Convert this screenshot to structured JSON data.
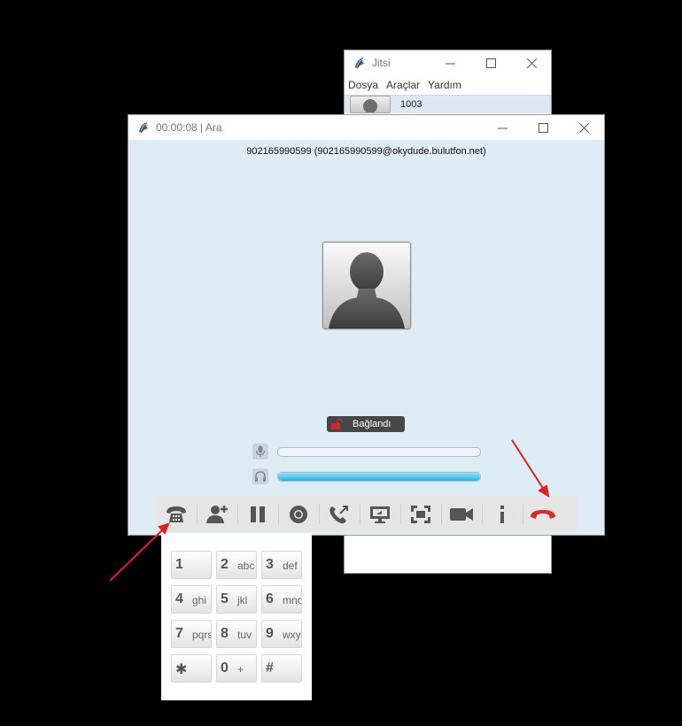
{
  "jitsi_window": {
    "title": "Jitsi",
    "menu": [
      "Dosya",
      "Araçlar",
      "Yardım"
    ],
    "contact_number": "1003"
  },
  "call_window": {
    "title": "00:00:08 | Ara",
    "remote_party": "902165990599 (902165990599@okydude.bulutfon.net)",
    "status": "Bağlandı",
    "mic_level": 0.0,
    "speaker_level": 1.0
  },
  "toolbar": {
    "buttons": [
      "dialpad-icon",
      "add-participant-icon",
      "pause-icon",
      "record-icon",
      "transfer-icon",
      "desktop-share-icon",
      "fullscreen-icon",
      "video-icon",
      "info-icon",
      "hangup-icon"
    ]
  },
  "dialpad": {
    "keys": [
      {
        "digit": "1",
        "letters": ""
      },
      {
        "digit": "2",
        "letters": "abc"
      },
      {
        "digit": "3",
        "letters": "def"
      },
      {
        "digit": "4",
        "letters": "ghi"
      },
      {
        "digit": "5",
        "letters": "jkl"
      },
      {
        "digit": "6",
        "letters": "mno"
      },
      {
        "digit": "7",
        "letters": "pqrs"
      },
      {
        "digit": "8",
        "letters": "tuv"
      },
      {
        "digit": "9",
        "letters": "wxyz"
      },
      {
        "digit": "✱",
        "letters": ""
      },
      {
        "digit": "0",
        "letters": "+"
      },
      {
        "digit": "#",
        "letters": ""
      }
    ]
  },
  "colors": {
    "accent_arrow": "#e02020",
    "hangup": "#d62b2b",
    "call_background": "#deecf5"
  }
}
